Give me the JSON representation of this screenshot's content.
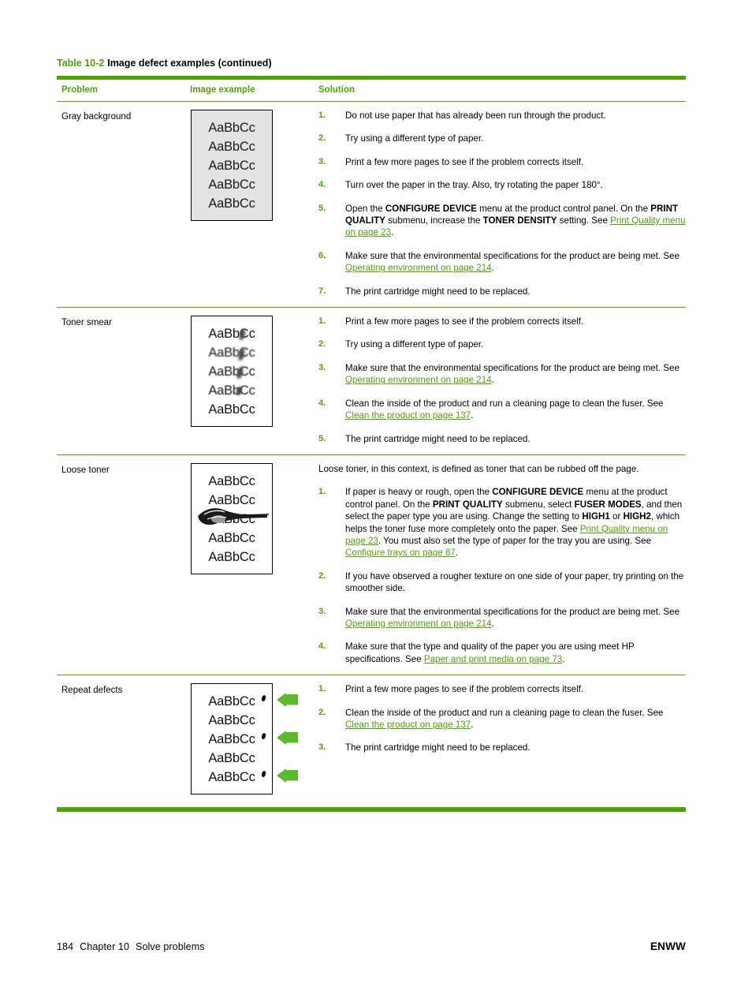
{
  "caption": {
    "number": "Table 10-2",
    "text": "Image defect examples (continued)"
  },
  "table": {
    "headers": {
      "problem": "Problem",
      "image_example": "Image example",
      "solution": "Solution"
    },
    "rows": [
      {
        "problem": "Gray background",
        "sample": {
          "type": "gray-background",
          "lines": [
            "AaBbCc",
            "AaBbCc",
            "AaBbCc",
            "AaBbCc",
            "AaBbCc"
          ]
        },
        "intro": "",
        "steps": [
          {
            "num": "1.",
            "html": "Do not use paper that has already been run through the product."
          },
          {
            "num": "2.",
            "html": "Try using a different type of paper."
          },
          {
            "num": "3.",
            "html": "Print a few more pages to see if the problem corrects itself."
          },
          {
            "num": "4.",
            "html": "Turn over the paper in the tray. Also, try rotating the paper 180&deg;."
          },
          {
            "num": "5.",
            "html": "Open the <span class=\"b\">CONFIGURE DEVICE</span> menu at the product control panel. On the <span class=\"b\">PRINT QUALITY</span> submenu, increase the <span class=\"b\">TONER DENSITY</span> setting. See <span class=\"lnk\">Print Quality menu on page 23</span>."
          },
          {
            "num": "6.",
            "html": "Make sure that the environmental specifications for the product are being met. See <span class=\"lnk\">Operating environment on page 214</span>."
          },
          {
            "num": "7.",
            "html": "The print cartridge might need to be replaced."
          }
        ]
      },
      {
        "problem": "Toner smear",
        "sample": {
          "type": "toner-smear",
          "lines": [
            "AaBbCc",
            "AaBbCc",
            "AaBbCc",
            "AaBbCc",
            "AaBbCc"
          ]
        },
        "intro": "",
        "steps": [
          {
            "num": "1.",
            "html": "Print a few more pages to see if the problem corrects itself."
          },
          {
            "num": "2.",
            "html": "Try using a different type of paper."
          },
          {
            "num": "3.",
            "html": "Make sure that the environmental specifications for the product are being met. See <span class=\"lnk\">Operating environment on page 214</span>."
          },
          {
            "num": "4.",
            "html": "Clean the inside of the product and run a cleaning page to clean the fuser. See <span class=\"lnk\">Clean the product on page 137</span>."
          },
          {
            "num": "5.",
            "html": "The print cartridge might need to be replaced."
          }
        ]
      },
      {
        "problem": "Loose toner",
        "sample": {
          "type": "loose-toner",
          "lines": [
            "AaBbCc",
            "AaBbCc",
            "AaBbCc",
            "AaBbCc",
            "AaBbCc"
          ]
        },
        "intro": "Loose toner, in this context, is defined as toner that can be rubbed off the page.",
        "steps": [
          {
            "num": "1.",
            "html": "If paper is heavy or rough, open the <span class=\"b\">CONFIGURE DEVICE</span> menu at the product control panel. On the <span class=\"b\">PRINT QUALITY</span> submenu, select <span class=\"b\">FUSER MODES</span>, and then select the paper type you are using. Change the setting to <span class=\"b\">HIGH1</span> or <span class=\"b\">HIGH2</span>, which helps the toner fuse more completely onto the paper. See <span class=\"lnk\">Print Quality menu on page 23</span>. You must also set the type of paper for the tray you are using. See <span class=\"lnk\">Configure trays on page 87</span>."
          },
          {
            "num": "2.",
            "html": "If you have observed a rougher texture on one side of your paper, try printing on the smoother side."
          },
          {
            "num": "3.",
            "html": "Make sure that the environmental specifications for the product are being met. See <span class=\"lnk\">Operating environment on page 214</span>."
          },
          {
            "num": "4.",
            "html": "Make sure that the type and quality of the paper you are using meet HP specifications. See <span class=\"lnk\">Paper and print media on page 73</span>."
          }
        ]
      },
      {
        "problem": "Repeat defects",
        "sample": {
          "type": "repeat-defects",
          "lines": [
            "AaBbCc",
            "AaBbCc",
            "AaBbCc",
            "AaBbCc",
            "AaBbCc"
          ],
          "arrow_count": 3
        },
        "intro": "",
        "steps": [
          {
            "num": "1.",
            "html": "Print a few more pages to see if the problem corrects itself."
          },
          {
            "num": "2.",
            "html": "Clean the inside of the product and run a cleaning page to clean the fuser. See <span class=\"lnk\">Clean the product on page 137</span>."
          },
          {
            "num": "3.",
            "html": "The print cartridge might need to be replaced."
          }
        ]
      }
    ]
  },
  "footer": {
    "page_number": "184",
    "chapter": "Chapter 10",
    "chapter_title": "Solve problems",
    "locale": "ENWW"
  },
  "colors": {
    "accent_green": "#4ea308",
    "link_green": "#4ea308",
    "arrow_green": "#5cb82c",
    "gray_background_sample": "#e3e3e3"
  }
}
